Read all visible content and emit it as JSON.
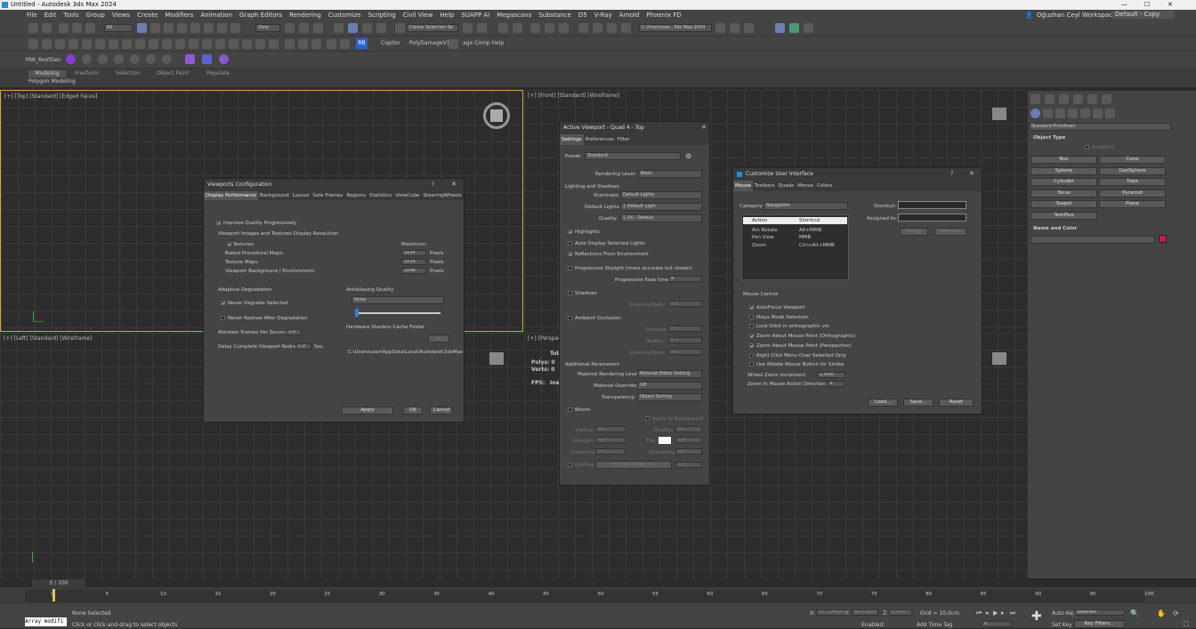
{
  "window": {
    "title": "Untitled - Autodesk 3ds Max 2024",
    "user": "Oğuzhan Ceyl",
    "workspaces_label": "Workspaces:",
    "workspace": "Default - Copy"
  },
  "menu": [
    "File",
    "Edit",
    "Tools",
    "Group",
    "Views",
    "Create",
    "Modifiers",
    "Animation",
    "Graph Editors",
    "Rendering",
    "Customize",
    "Scripting",
    "Civil View",
    "Help",
    "SUAPP AI",
    "Megascans",
    "Substance",
    "D5",
    "V-Ray",
    "Arnold",
    "Phoenix FD"
  ],
  "toolbar": {
    "filter": "All",
    "view": "View",
    "selection_set": "Create Selection Se",
    "path": "C:\\Users\\use...3ds Max 2024",
    "copitor": "Copitor",
    "poly_damage": "PolyDamageV1",
    "age_comp": "age Comp Help",
    "rb": "RB",
    "roofgen": "MW_RoofGen"
  },
  "ribbon": {
    "tabs": [
      "Modeling",
      "Freeform",
      "Selection",
      "Object Paint",
      "Populate"
    ],
    "sub": "Polygon Modeling"
  },
  "viewports": {
    "top": "[+] [Top] [Standard] [Edged Faces]",
    "front": "[+] [Front] [Standard] [Wireframe]",
    "left": "[+] [Left] [Standard] [Wireframe]",
    "persp": "[+] [Perspective] [Standard] [Default Shading]"
  },
  "stats": {
    "total": "Tot",
    "polys": "Polys: 0",
    "verts": "Verts: 0",
    "fps": "FPS:",
    "fps_val": "Ina"
  },
  "vpconfig": {
    "title": "Viewports Configuration",
    "help": "?",
    "tabs": [
      "Display Performance",
      "Background",
      "Layout",
      "Safe Frames",
      "Regions",
      "Statistics",
      "ViewCube",
      "SteeringWheels"
    ],
    "improve": "Improve Quality Progressively",
    "section": "Viewport Images and Textures Display Resolution",
    "textures": "Textures",
    "maximum": "Maximum:",
    "rows": [
      {
        "label": "Baked Procedural Maps:",
        "value": "1024",
        "unit": "Pixels"
      },
      {
        "label": "Texture Maps:",
        "value": "1024",
        "unit": "Pixels"
      },
      {
        "label": "Viewport Background / Environment:",
        "value": "2048",
        "unit": "Pixels"
      }
    ],
    "adaptive": "Adaptive Degradation",
    "never_degrade": "Never Degrade Selected",
    "never_redraw": "Never Redraw After Degradation",
    "maintain": "Maintain Frames Per Second:",
    "maintain_val": "2,0",
    "delay": "Delay Complete Viewport Redraw:",
    "delay_val": "1,0",
    "sec": "Sec.",
    "aa": "Antialiasing Quality",
    "aa_val": "None",
    "cache": "Hardware Shaders Cache Folder",
    "browse": "...",
    "path": "C:\\Users\\user\\AppData\\Local\\Autodesk\\3dsMax",
    "apply": "Apply",
    "ok": "OK",
    "cancel": "Cancel"
  },
  "active": {
    "title": "Active Viewport - Quad 4 - Top",
    "tabs": [
      "Settings",
      "Preferences",
      "Filter"
    ],
    "preset_label": "Preset:",
    "preset": "Standard",
    "render_level_label": "Rendering Level:",
    "render_level": "Basic",
    "lighting": "Lighting and Shadows",
    "illuminate_label": "Illuminate:",
    "illuminate": "Default Lights",
    "default_lights_label": "Default Lights:",
    "default_lights": "1 Default Light",
    "quality_label": "Quality:",
    "quality": "1.0X - Default",
    "highlights": "Highlights",
    "auto_display": "Auto Display Selected Lights",
    "reflections": "Reflections From Environment",
    "skylight": "Progressive Skylight (more accurate but slower)",
    "fade_label": "Progressive Fade time:",
    "fade": "4",
    "shadows": "Shadows",
    "intensity_label": "Intensity/Fade:",
    "intensity": "1,0",
    "ao": "Ambient Occlusion",
    "samples_label": "Samples:",
    "samples": "64",
    "radius_label": "Radius:",
    "radius": "1,0",
    "intensity2_label": "Intensity/Fade:",
    "intensity2": "1,5",
    "additional": "Additional Parameters",
    "mat_level_label": "Material Rendering Level:",
    "mat_level": "Material Editor Setting",
    "mat_override_label": "Material Override:",
    "mat_override": "Off",
    "transparency_label": "Transparency:",
    "transparency": "Object Sorting",
    "bloom": "Bloom",
    "apply_bg": "Apply to Background",
    "bloom_rows": [
      {
        "l": "Radius:",
        "v": "10",
        "r": "Quality:",
        "rv": "4"
      },
      {
        "l": "Strength:",
        "v": "0,2",
        "r": "Tint:",
        "rv": "1,0"
      },
      {
        "l": "Threshold:",
        "v": "0,2",
        "r": "Smoothing:",
        "rv": "0,0"
      }
    ],
    "dirtmap": "DirtMap",
    "no_image": "<< No Image >>",
    "dirt_val": "1,0"
  },
  "cui": {
    "title": "Customize User Interface",
    "help": "?",
    "tabs": [
      "Mouse",
      "Toolbars",
      "Quads",
      "Menus",
      "Colors"
    ],
    "category_label": "Category:",
    "category": "Navigation",
    "col_action": "Action",
    "col_shortcut": "Shortcut",
    "rows": [
      {
        "a": "Arc Rotate",
        "s": "Alt+MMB"
      },
      {
        "a": "Pan View",
        "s": "MMB"
      },
      {
        "a": "Zoom",
        "s": "Ctrl+Alt+MMB"
      }
    ],
    "shortcut_label": "Shortcut:",
    "assigned_label": "Assigned to:",
    "assign": "Assign",
    "remove": "Remove",
    "mouse_control": "Mouse Control",
    "options": [
      {
        "t": "AutoFocus Viewport",
        "on": true
      },
      {
        "t": "Maya Mode Selection",
        "on": false
      },
      {
        "t": "Lock Orbit in orthographic vie",
        "on": false
      },
      {
        "t": "Zoom About Mouse Point (Orthographic)",
        "on": true
      },
      {
        "t": "Zoom About Mouse Point (Perspective)",
        "on": true
      },
      {
        "t": "Right Click Menu Over Selected Only",
        "on": false
      },
      {
        "t": "Use Middle Mouse Button for Stroke",
        "on": false
      }
    ],
    "wheel_label": "Wheel Zoom Increment:",
    "wheel": "1,0cm",
    "zoom_dir_label": "Zoom In Mouse Action Direction:",
    "zoom_dir": "+",
    "load": "Load...",
    "save": "Save...",
    "reset": "Reset"
  },
  "cmd": {
    "dropdown": "Standard Primitives",
    "object_type": "Object Type",
    "autogrid": "AutoGrid",
    "buttons": [
      "Box",
      "Cone",
      "Sphere",
      "GeoSphere",
      "Cylinder",
      "Tube",
      "Torus",
      "Pyramid",
      "Teapot",
      "Plane",
      "TextPlus"
    ],
    "name_color": "Name and Color",
    "swatch": "#c2185b"
  },
  "timeline": {
    "frame": "0 / 100",
    "ticks": [
      "0",
      "5",
      "10",
      "15",
      "20",
      "25",
      "30",
      "35",
      "40",
      "45",
      "50",
      "55",
      "60",
      "65",
      "70",
      "75",
      "80",
      "85",
      "90",
      "95",
      "100"
    ]
  },
  "status": {
    "script": "Array modifi",
    "none_selected": "None Selected",
    "hint": "Click or click-and-drag to select objects",
    "x_label": "X:",
    "x": "211,286cm",
    "y_label": "Y:",
    "y": "96,836cm",
    "z_label": "Z:",
    "z": "0,0cm",
    "grid": "Grid = 10,0cm",
    "enabled": "Enabled:",
    "add_time_tag": "Add Time Tag",
    "auto_key": "Auto Key",
    "selected": "Selected",
    "set_key": "Set Key",
    "key_filters": "Key Filters...",
    "frame": "0"
  }
}
